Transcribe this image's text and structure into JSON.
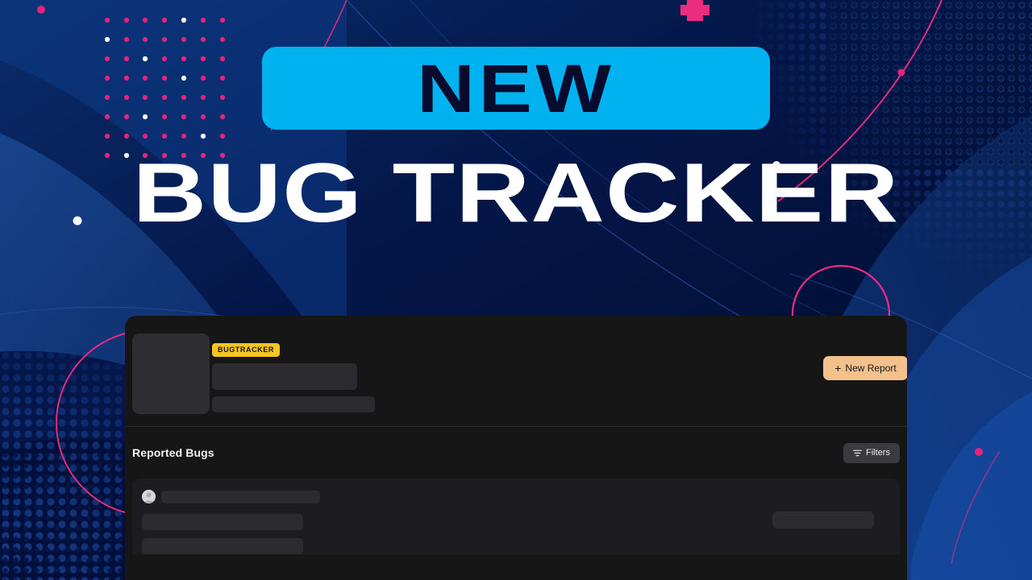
{
  "hero": {
    "badge_label": "NEW",
    "title": "BUG TRACKER",
    "badge_color": "#00b2f0",
    "title_color": "#ffffff"
  },
  "app_card": {
    "brand_badge": "BUGTRACKER",
    "brand_badge_color": "#f7c521",
    "new_report_button": {
      "label": "New Report",
      "icon": "plus-icon",
      "color": "#f4c08c"
    }
  },
  "bug_list": {
    "section_title": "Reported Bugs",
    "filters_button": {
      "label": "Filters",
      "icon": "funnel-icon"
    },
    "rows": [
      {
        "avatar": "user-avatar-icon"
      }
    ]
  },
  "background": {
    "base_color": "#000a2a",
    "accent_pink": "#ec2c80",
    "accent_blue": "#1b4fa8",
    "card_color": "#161616"
  }
}
